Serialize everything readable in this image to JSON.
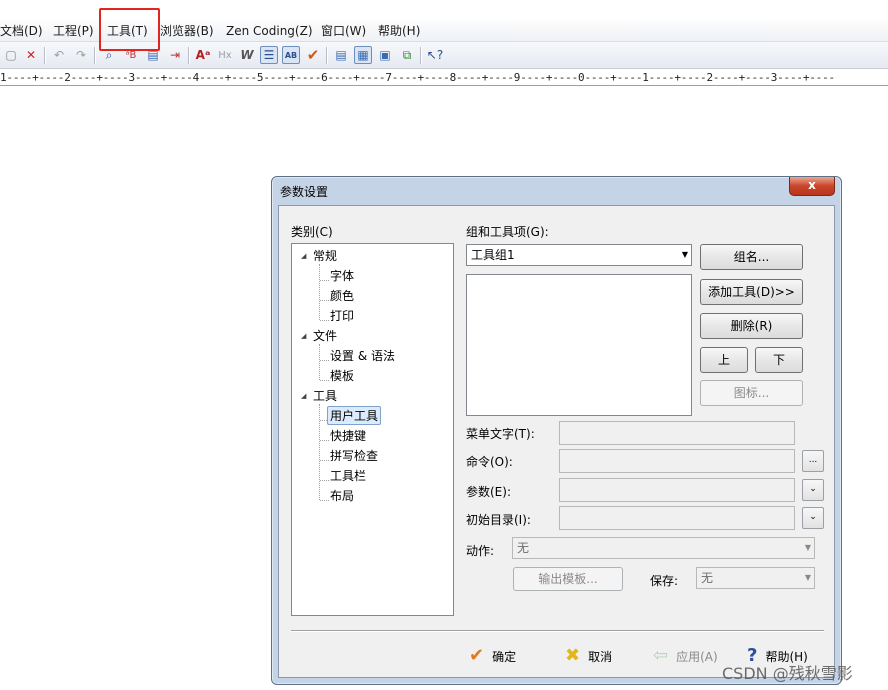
{
  "menubar": {
    "items": [
      "文档(D)",
      "工程(P)",
      "工具(T)",
      "浏览器(B)",
      "Zen Coding(Z)",
      "窗口(W)",
      "帮助(H)"
    ]
  },
  "toolbar": {
    "icons": [
      "paste-icon",
      "delete-icon",
      "undo-icon",
      "redo-icon",
      "find-icon",
      "replace-icon",
      "goto-icon",
      "indent-icon",
      "font-icon",
      "hex-icon",
      "word-wrap-icon",
      "line-number-icon",
      "spell-check-icon",
      "check-icon",
      "view1-icon",
      "view2-icon",
      "view3-icon",
      "view4-icon",
      "help-pointer-icon"
    ]
  },
  "ruler": {
    "text": "1----+----2----+----3----+----4----+----5----+----6----+----7----+----8----+----9----+----0----+----1----+----2----+----3----+----"
  },
  "dialog": {
    "title": "参数设置",
    "close_label": "x",
    "category_label": "类别(C)",
    "category_key": "C",
    "tree": [
      {
        "label": "常规",
        "expanded": true
      },
      {
        "label": "字体"
      },
      {
        "label": "颜色"
      },
      {
        "label": "打印"
      },
      {
        "label": "文件",
        "expanded": true
      },
      {
        "label": "设置 & 语法"
      },
      {
        "label": "模板"
      },
      {
        "label": "工具",
        "expanded": true
      },
      {
        "label": "用户工具",
        "selected": true
      },
      {
        "label": "快捷键"
      },
      {
        "label": "拼写检查"
      },
      {
        "label": "工具栏"
      },
      {
        "label": "布局"
      }
    ],
    "group_label": "组和工具项(G):",
    "group_selected": "工具组1",
    "buttons": {
      "group_name": "组名...",
      "add_tool": "添加工具(D)>>",
      "delete": "删除(R)",
      "up": "上",
      "down": "下",
      "icon": "图标..."
    },
    "fields": {
      "menu_text": "菜单文字(T):",
      "command": "命令(O):",
      "params": "参数(E):",
      "init_dir": "初始目录(I):",
      "action": "动作:",
      "action_value": "无",
      "output_template": "输出模板...",
      "save": "保存:",
      "save_value": "无",
      "browse": "..."
    },
    "footer": {
      "ok": "确定",
      "cancel": "取消",
      "apply": "应用(A)",
      "help": "帮助(H)"
    }
  },
  "watermark": "CSDN @残秋雪影",
  "colors": {
    "highlight": "#e0261f",
    "dialog_frame": "#c4d3e6",
    "close_button": "#c9452a"
  }
}
